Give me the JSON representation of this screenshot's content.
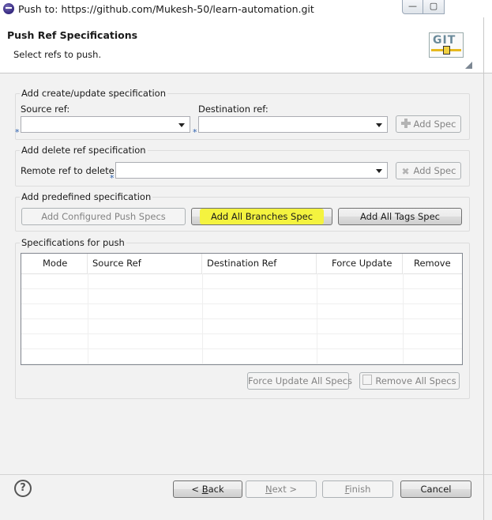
{
  "window": {
    "title": "Push to: https://github.com/Mukesh-50/learn-automation.git",
    "minimize_glyph": "—",
    "maximize_glyph": "▢"
  },
  "header": {
    "title": "Push Ref Specifications",
    "subtitle": "Select refs to push.",
    "logo_text": "GIT"
  },
  "create_update": {
    "group_label": "Add create/update specification",
    "source_label": "Source ref:",
    "source_value": "",
    "destination_label": "Destination ref:",
    "destination_value": "",
    "required_marker": "*",
    "add_button": "Add Spec"
  },
  "delete_spec": {
    "group_label": "Add delete ref specification",
    "remote_label": "Remote ref to delete:",
    "remote_value": "",
    "required_marker": "*",
    "add_button": "Add Spec"
  },
  "predefined": {
    "group_label": "Add predefined specification",
    "configured_button": "Add Configured Push Specs",
    "all_branches_button": "Add All Branches Spec",
    "all_tags_button": "Add All Tags Spec",
    "highlight_color": "#f4f33f"
  },
  "specs": {
    "group_label": "Specifications for push",
    "columns": [
      "Mode",
      "Source Ref",
      "Destination Ref",
      "Force Update",
      "Remove"
    ],
    "rows": [],
    "force_update_all_button": "Force Update All Specs",
    "remove_all_button": "Remove All Specs"
  },
  "footer": {
    "help_glyph": "?",
    "back_prefix": "< ",
    "back_mnemonic": "B",
    "back_rest": "ack",
    "next_mnemonic": "N",
    "next_rest": "ext >",
    "finish_mnemonic": "F",
    "finish_rest": "inish",
    "cancel_label": "Cancel"
  }
}
